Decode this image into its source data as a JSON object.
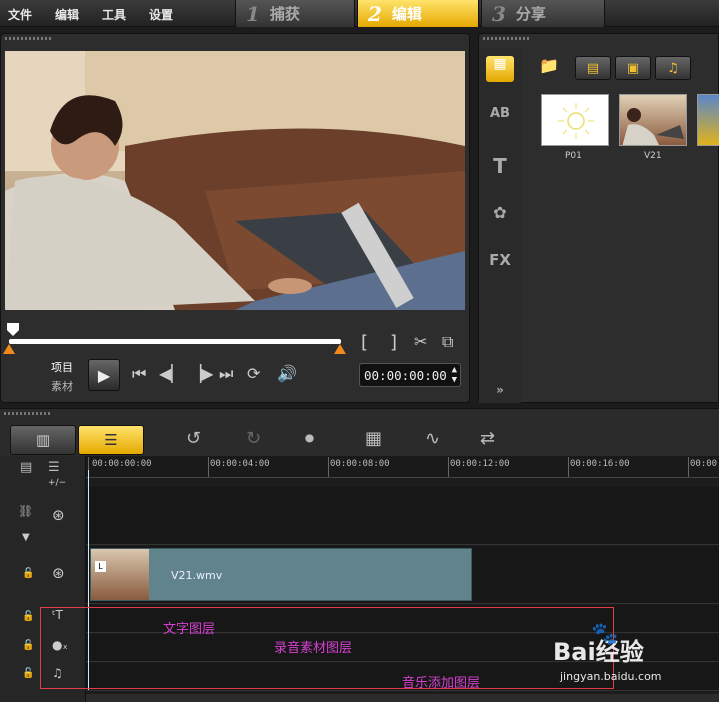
{
  "menu": {
    "items": [
      "文件",
      "编辑",
      "工具",
      "设置"
    ]
  },
  "steps": [
    {
      "num": "1",
      "label": "捕获",
      "active": false
    },
    {
      "num": "2",
      "label": "编辑",
      "active": true
    },
    {
      "num": "3",
      "label": "分享",
      "active": false
    }
  ],
  "preview": {
    "mode_project": "项目",
    "mode_clip": "素材",
    "mark_in": "[",
    "mark_out": "]",
    "timecode": "00:00:00:00"
  },
  "library": {
    "side_icons": [
      "AB",
      "T",
      "FX"
    ],
    "thumbs": [
      {
        "label": "P01"
      },
      {
        "label": "V21"
      }
    ]
  },
  "timeline": {
    "ruler": [
      "00:00:00:00",
      "00:00:04:00",
      "00:00:08:00",
      "00:00:12:00",
      "00:00:16:00",
      "00:00"
    ],
    "add_remove": "+/−",
    "clip_name": "V21.wmv"
  },
  "annotations": {
    "text_layer": "文字图层",
    "voice_layer": "录音素材图层",
    "music_layer": "音乐添加图层"
  },
  "watermark": {
    "brand": "Bai经验",
    "url": "jingyan.baidu.com"
  },
  "colors": {
    "accent": "#f5b800",
    "annot_text": "#d640d0",
    "annot_box": "#e23b4c",
    "clip": "#60838c"
  }
}
